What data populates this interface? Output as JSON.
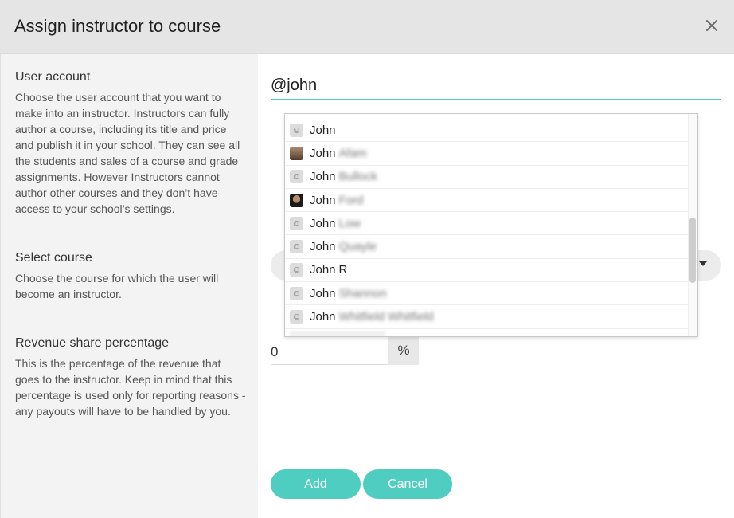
{
  "dialog": {
    "title": "Assign instructor to course",
    "close_label": "×"
  },
  "sections": {
    "user_account": {
      "title": "User account",
      "description": "Choose the user account that you want to make into an instructor. Instructors can fully author a course, including its title and price and publish it in your school. They can see all the students and sales of a course and grade assignments. However Instructors cannot author other courses and they don’t have access to your school’s settings."
    },
    "select_course": {
      "title": "Select course",
      "description": "Choose the course for which the user will become an instructor."
    },
    "revenue_share": {
      "title": "Revenue share percentage",
      "description": "This is the percentage of the revenue that goes to the instructor. Keep in mind that this percentage is used only for reporting reasons - any payouts will have to be handled by you."
    }
  },
  "form": {
    "user_search_value": "@john",
    "revenue_value": "0",
    "percent_symbol": "%",
    "add_label": "Add",
    "cancel_label": "Cancel"
  },
  "dropdown": {
    "items": [
      {
        "first": "John",
        "last": "",
        "avatar": "default-face-icon"
      },
      {
        "first": "John",
        "last": "Afam",
        "avatar": "user-photo-icon"
      },
      {
        "first": "John",
        "last": "Bullock",
        "avatar": "default-face-icon"
      },
      {
        "first": "John",
        "last": "Ford",
        "avatar": "user-photo-icon"
      },
      {
        "first": "John",
        "last": "Low",
        "avatar": "default-face-icon"
      },
      {
        "first": "John",
        "last": "Quayle",
        "avatar": "default-face-icon"
      },
      {
        "first": "John",
        "last": "R",
        "avatar": "default-face-icon"
      },
      {
        "first": "John",
        "last": "Shannon",
        "avatar": "default-face-icon"
      },
      {
        "first": "John",
        "last": "Whitfield Whitfield",
        "avatar": "default-face-icon"
      }
    ]
  },
  "colors": {
    "accent": "#4ecdc0",
    "header_bg": "#e5e5e5",
    "left_panel_bg": "#f3f3f3"
  }
}
